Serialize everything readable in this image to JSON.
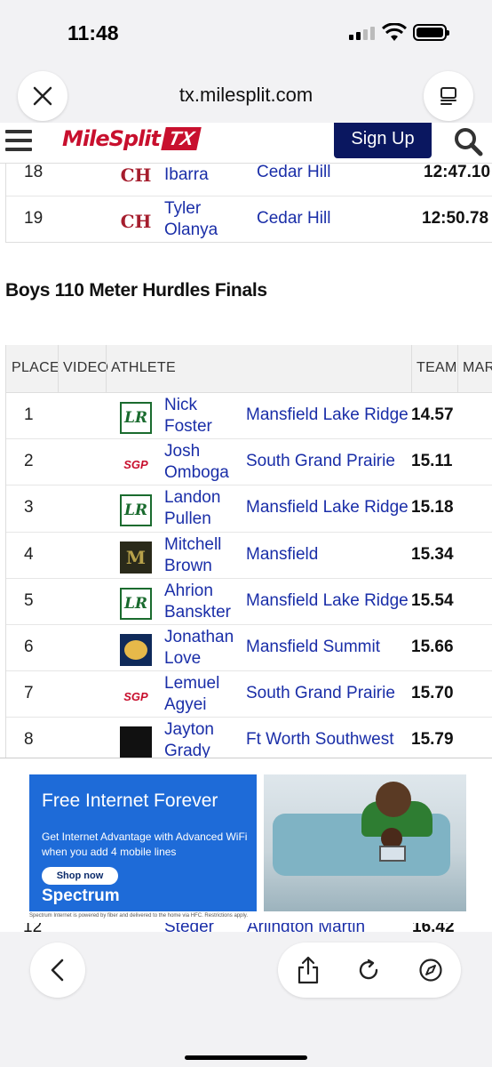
{
  "status": {
    "time": "11:48"
  },
  "browser": {
    "url": "tx.milesplit.com"
  },
  "site": {
    "logo_main": "MileSplit",
    "logo_state": "TX",
    "signup_label": "Sign Up"
  },
  "previous_results": [
    {
      "place": "18",
      "athlete": "Ibarra",
      "athlete_first": "",
      "team": "Cedar Hill",
      "mark": "12:47.10",
      "logo": "ch"
    },
    {
      "place": "19",
      "athlete_first": "Tyler",
      "athlete": "Olanya",
      "team": "Cedar Hill",
      "mark": "12:50.78",
      "logo": "ch"
    }
  ],
  "event": {
    "title": "Boys 110 Meter Hurdles Finals",
    "columns": {
      "place": "PLACE",
      "video": "VIDEO",
      "athlete": "ATHLETE",
      "team": "TEAM",
      "mark": "MAR"
    },
    "rows": [
      {
        "place": "1",
        "first": "Nick",
        "last": "Foster",
        "team": "Mansfield Lake Ridge",
        "mark": "14.57",
        "logo": "LR"
      },
      {
        "place": "2",
        "first": "Josh",
        "last": "Omboga",
        "team": "South Grand Prairie",
        "mark": "15.11",
        "logo": "SGP"
      },
      {
        "place": "3",
        "first": "Landon",
        "last": "Pullen",
        "team": "Mansfield Lake Ridge",
        "mark": "15.18",
        "logo": "LR"
      },
      {
        "place": "4",
        "first": "Mitchell",
        "last": "Brown",
        "team": "Mansfield",
        "mark": "15.34",
        "logo": "M"
      },
      {
        "place": "5",
        "first": "Ahrion",
        "last": "Banskter",
        "team": "Mansfield Lake Ridge",
        "mark": "15.54",
        "logo": "LR"
      },
      {
        "place": "6",
        "first": "Jonathan",
        "last": "Love",
        "team": "Mansfield Summit",
        "mark": "15.66",
        "logo": "summit"
      },
      {
        "place": "7",
        "first": "Lemuel",
        "last": "Agyei",
        "team": "South Grand Prairie",
        "mark": "15.70",
        "logo": "SGP"
      },
      {
        "place": "8",
        "first": "Jayton",
        "last": "Grady",
        "team": "Ft Worth Southwest",
        "mark": "15.79",
        "logo": "sw"
      }
    ],
    "peek_row": {
      "place": "12",
      "last": "Steger",
      "team": "Arlington Martin",
      "mark": "16.42"
    }
  },
  "ad": {
    "headline": "Free Internet Forever",
    "subtext": "Get Internet Advantage with Advanced WiFi when you add 4 mobile lines",
    "cta": "Shop now",
    "brand": "Spectrum",
    "footnote": "Spectrum Internet is powered by fiber and delivered to the home via HFC. Restrictions apply."
  },
  "colors": {
    "link": "#1a2ea8",
    "brand_red": "#c8102e",
    "signup_bg": "#0a1760",
    "ad_blue": "#1e6bd8"
  },
  "icons": [
    "close-icon",
    "tabs-icon",
    "hamburger-icon",
    "search-icon",
    "back-icon",
    "share-icon",
    "reload-icon",
    "compass-icon"
  ]
}
